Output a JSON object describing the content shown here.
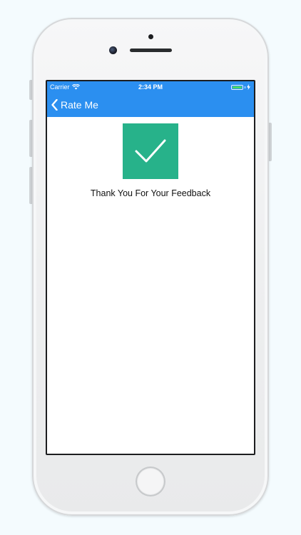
{
  "status_bar": {
    "carrier": "Carrier",
    "time": "2:34 PM",
    "wifi_icon": "wifi-icon",
    "battery_icon": "battery-icon",
    "charging_icon": "bolt-icon"
  },
  "nav": {
    "back_label": "Rate Me",
    "back_icon": "chevron-left-icon",
    "color": "#2b8ff0"
  },
  "content": {
    "check_icon": "checkmark-icon",
    "check_color": "#27b28a",
    "message": "Thank You For Your Feedback"
  }
}
